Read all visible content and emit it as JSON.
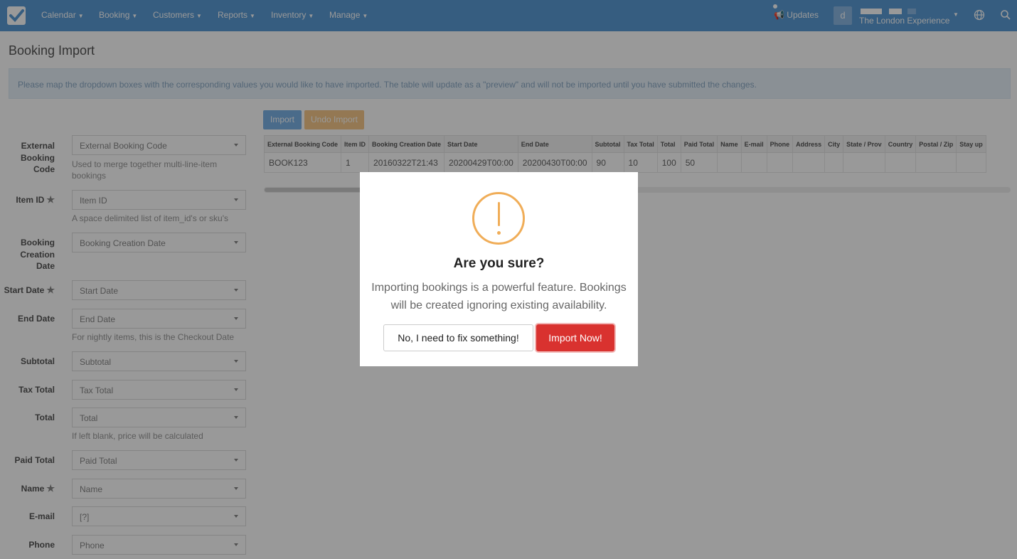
{
  "nav": {
    "items": [
      {
        "label": "Calendar"
      },
      {
        "label": "Booking"
      },
      {
        "label": "Customers"
      },
      {
        "label": "Reports"
      },
      {
        "label": "Inventory"
      },
      {
        "label": "Manage"
      }
    ],
    "updates_label": "Updates",
    "avatar_initial": "d",
    "account_name": "The London Experience"
  },
  "page": {
    "title": "Booking Import",
    "info": "Please map the dropdown boxes with the corresponding values you would like to have imported. The table will update as a \"preview\" and will not be imported until you have submitted the changes."
  },
  "form": {
    "fields": [
      {
        "label": "External Booking Code",
        "value": "External Booking Code",
        "help": "Used to merge together multi-line-item bookings"
      },
      {
        "label": "Item ID",
        "value": "Item ID",
        "help": "A space delimited list of item_id's or sku's"
      },
      {
        "label": "Booking Creation Date",
        "value": "Booking Creation Date"
      },
      {
        "label": "Start Date",
        "value": "Start Date"
      },
      {
        "label": "End Date",
        "value": "End Date",
        "help": "For nightly items, this is the Checkout Date"
      },
      {
        "label": "Subtotal",
        "value": "Subtotal"
      },
      {
        "label": "Tax Total",
        "value": "Tax Total"
      },
      {
        "label": "Total",
        "value": "Total",
        "help": "If left blank, price will be calculated"
      },
      {
        "label": "Paid Total",
        "value": "Paid Total"
      },
      {
        "label": "Name",
        "value": "Name"
      },
      {
        "label": "E-mail",
        "value": "[?]"
      },
      {
        "label": "Phone",
        "value": "Phone"
      }
    ]
  },
  "actions": {
    "import_label": "Import",
    "undo_label": "Undo Import"
  },
  "table": {
    "headers": [
      "External Booking Code",
      "Item ID",
      "Booking Creation Date",
      "Start Date",
      "End Date",
      "Subtotal",
      "Tax Total",
      "Total",
      "Paid Total",
      "Name",
      "E-mail",
      "Phone",
      "Address",
      "City",
      "State / Prov",
      "Country",
      "Postal / Zip",
      "Stay up"
    ],
    "rows": [
      [
        "BOOK123",
        "1",
        "20160322T21:43",
        "20200429T00:00",
        "20200430T00:00",
        "90",
        "10",
        "100",
        "50",
        "",
        "",
        "",
        "",
        "",
        "",
        "",
        "",
        ""
      ]
    ]
  },
  "modal": {
    "title": "Are you sure?",
    "text": "Importing bookings is a powerful feature. Bookings will be created ignoring existing availability.",
    "cancel_label": "No, I need to fix something!",
    "confirm_label": "Import Now!"
  },
  "colors": {
    "nav": "#5b9bd5",
    "warning": "#f0ad58",
    "danger": "#d9322f"
  }
}
